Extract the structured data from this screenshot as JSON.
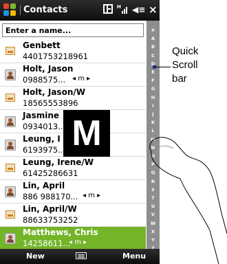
{
  "title_bar": {
    "app_title": "Contacts",
    "close_label": "×",
    "status_icons": [
      "connection-icon",
      "signal-icon",
      "volume-icon"
    ]
  },
  "search": {
    "placeholder": "Enter a name..."
  },
  "contacts": [
    {
      "name": "Genbett",
      "number": "4401753218961",
      "more": "",
      "icon": "card-icon"
    },
    {
      "name": "Holt, Jason",
      "number": "0988575...",
      "more": "◂ m ▸",
      "icon": "person-icon"
    },
    {
      "name": "Holt, Jason/W",
      "number": "18565553896",
      "more": "",
      "icon": "card-icon"
    },
    {
      "name": "Jasmine",
      "number": "0934013...",
      "more": "",
      "icon": "person-icon"
    },
    {
      "name": "Leung, I",
      "number": "6193975...",
      "more": "",
      "icon": "person-icon"
    },
    {
      "name": "Leung, Irene/W",
      "number": "61425286631",
      "more": "",
      "icon": "card-icon"
    },
    {
      "name": "Lin, April",
      "number": "886 988170...",
      "more": "◂ m ▸",
      "icon": "person-icon"
    },
    {
      "name": "Lin, April/W",
      "number": "88633753252",
      "more": "",
      "icon": "card-icon"
    },
    {
      "name": "Matthews, Chris",
      "number": "14258611...",
      "more": "◂ m ▸",
      "icon": "person-icon",
      "selected": true
    }
  ],
  "alpha_bar": {
    "letters": [
      "#",
      "A",
      "B",
      "C",
      "D",
      "E",
      "F",
      "G",
      "H",
      "I",
      "J",
      "K",
      "L",
      "M",
      "N",
      "O",
      "P",
      "Q",
      "R",
      "S",
      "T",
      "U",
      "V",
      "W",
      "X",
      "Y",
      "Z"
    ]
  },
  "scroll_overlay_letter": "M",
  "menu_bar": {
    "left": "New",
    "right": "Menu"
  },
  "callout": {
    "line1": "Quick",
    "line2": "Scroll",
    "line3": "bar"
  }
}
